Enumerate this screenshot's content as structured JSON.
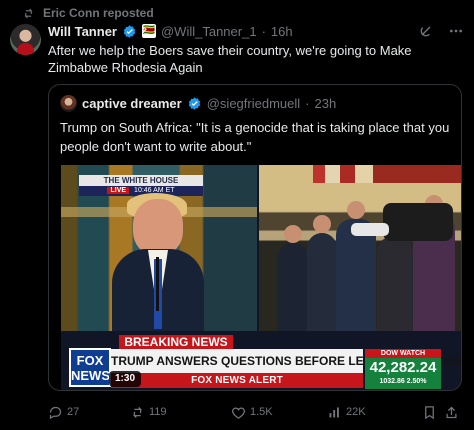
{
  "repost": {
    "label": "Eric Conn reposted",
    "icon": "repost-icon"
  },
  "tweet": {
    "author": "Will Tanner",
    "handle": "@Will_Tanner_1",
    "time": "16h",
    "text": "After we help the Boers save their country, we're going to Make Zimbabwe Rhodesia Again",
    "badges": [
      "verified-icon",
      "flag-icon"
    ],
    "accent": "#1d9bf0"
  },
  "quote": {
    "author": "captive dreamer",
    "handle": "@siegfriedmuell",
    "time": "23h",
    "text": "Trump on South Africa: \"It is a genocide that is taking place that you people don't want to write about.\""
  },
  "video": {
    "duration": "1:30",
    "white_house_label": "THE WHITE HOUSE",
    "live_label": "LIVE",
    "live_time": "10:46 AM ET",
    "breaking_label": "BREAKING NEWS",
    "headline": "TRUMP ANSWERS QUESTIONS BEFORE LEAVING FOR MIDEAST",
    "network_logo": "FOX NEWS",
    "alert_text": "FOX NEWS ALERT",
    "dow_label": "DOW WATCH",
    "dow_value": "42,282.24",
    "dow_change": "1032.86 2.50%"
  },
  "actions": {
    "replies": "27",
    "reposts": "119",
    "likes": "1.5K",
    "views": "22K"
  },
  "colors": {
    "background": "#000000",
    "text": "#e7e9ea",
    "muted": "#71767b",
    "border": "#2f3336"
  }
}
